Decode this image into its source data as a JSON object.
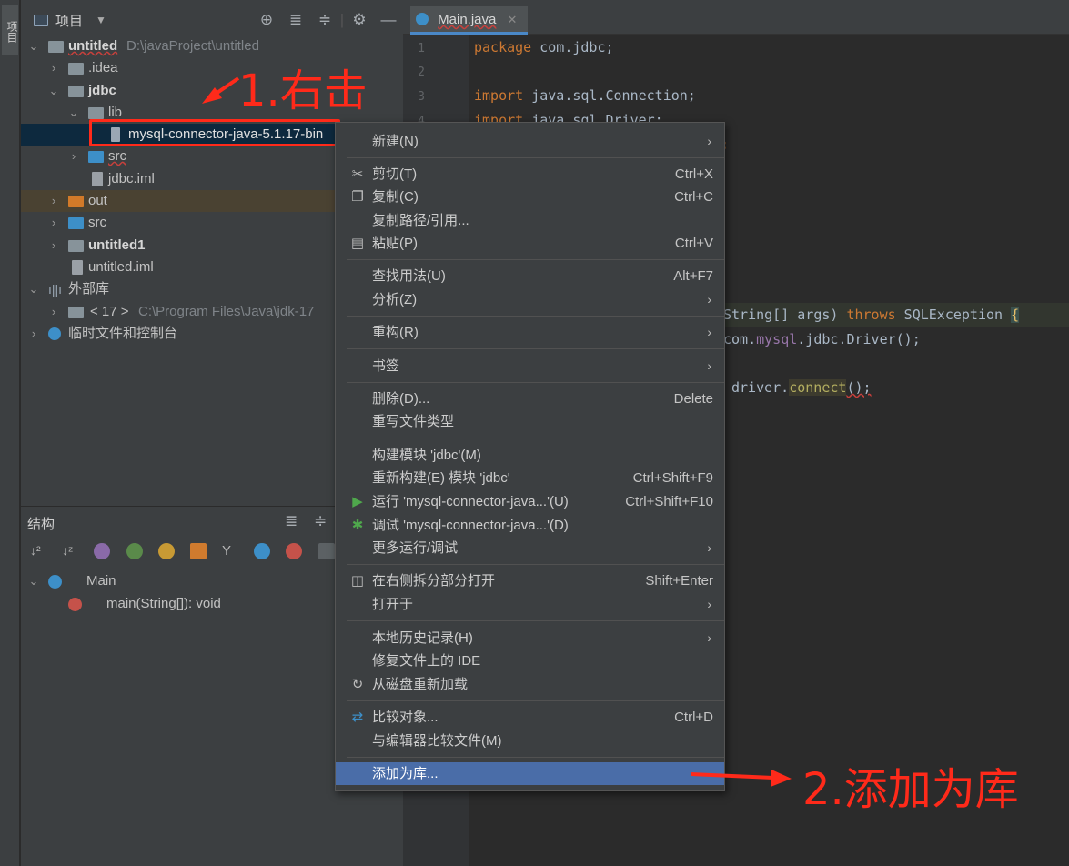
{
  "side_strip": {
    "tab_label": "项目"
  },
  "project": {
    "header_title": "项目",
    "tree": [
      {
        "label": "untitled",
        "path": "D:\\javaProject\\untitled"
      },
      {
        "label": ".idea"
      },
      {
        "label": "jdbc"
      },
      {
        "label": "lib"
      },
      {
        "label": "mysql-connector-java-5.1.17-bin"
      },
      {
        "label": "src"
      },
      {
        "label": "jdbc.iml"
      },
      {
        "label": "out"
      },
      {
        "label": "src"
      },
      {
        "label": "untitled1"
      },
      {
        "label": "untitled.iml"
      },
      {
        "label": "外部库"
      },
      {
        "label": "< 17 >",
        "path": "C:\\Program Files\\Java\\jdk-17"
      },
      {
        "label": "临时文件和控制台"
      }
    ]
  },
  "structure": {
    "title": "结构",
    "items": [
      {
        "label": "Main"
      },
      {
        "label": "main(String[]): void"
      }
    ]
  },
  "editor": {
    "tab_label": "Main.java",
    "line_numbers": [
      "1",
      "2",
      "3",
      "4"
    ],
    "code": {
      "l1_kw": "package",
      "l1_rest": " com.jdbc;",
      "l3_kw": "import",
      "l3_rest": " java.sql.Connection;",
      "l4_kw": "import",
      "l4_rest": " java.sql.Driver;",
      "l5_rest": ";",
      "l12_pre": "String[] args) ",
      "l12_kw": "throws",
      "l12_post": " SQLException ",
      "l12_brace": "{",
      "l13_pre": "com.",
      "l13_fld": "mysql",
      "l13_post": ".jdbc.Driver();",
      "l15_pre": "driver.",
      "l15_fn": "connect",
      "l15_post": "();"
    }
  },
  "context_menu": {
    "items": [
      {
        "label": "新建(N)",
        "shortcut": ""
      },
      {
        "label": "剪切(T)",
        "shortcut": "Ctrl+X"
      },
      {
        "label": "复制(C)",
        "shortcut": "Ctrl+C"
      },
      {
        "label": "复制路径/引用...",
        "shortcut": ""
      },
      {
        "label": "粘贴(P)",
        "shortcut": "Ctrl+V"
      },
      {
        "label": "查找用法(U)",
        "shortcut": "Alt+F7"
      },
      {
        "label": "分析(Z)",
        "shortcut": ""
      },
      {
        "label": "重构(R)",
        "shortcut": ""
      },
      {
        "label": "书签",
        "shortcut": ""
      },
      {
        "label": "删除(D)...",
        "shortcut": "Delete"
      },
      {
        "label": "重写文件类型",
        "shortcut": ""
      },
      {
        "label": "构建模块 'jdbc'(M)",
        "shortcut": ""
      },
      {
        "label": "重新构建(E) 模块 'jdbc'",
        "shortcut": "Ctrl+Shift+F9"
      },
      {
        "label": "运行 'mysql-connector-java...'(U)",
        "shortcut": "Ctrl+Shift+F10"
      },
      {
        "label": "调试 'mysql-connector-java...'(D)",
        "shortcut": ""
      },
      {
        "label": "更多运行/调试",
        "shortcut": ""
      },
      {
        "label": "在右侧拆分部分打开",
        "shortcut": "Shift+Enter"
      },
      {
        "label": "打开于",
        "shortcut": ""
      },
      {
        "label": "本地历史记录(H)",
        "shortcut": ""
      },
      {
        "label": "修复文件上的 IDE",
        "shortcut": ""
      },
      {
        "label": "从磁盘重新加载",
        "shortcut": ""
      },
      {
        "label": "比较对象...",
        "shortcut": "Ctrl+D"
      },
      {
        "label": "与编辑器比较文件(M)",
        "shortcut": ""
      },
      {
        "label": "添加为库...",
        "shortcut": ""
      }
    ]
  },
  "annotations": {
    "step1": "1.右击",
    "step2": "2.添加为库"
  },
  "colors": {
    "accent_red": "#ff2a1a",
    "menu_selected": "#4a6da8",
    "panel_bg": "#3c3f41",
    "editor_bg": "#2b2b2b"
  }
}
